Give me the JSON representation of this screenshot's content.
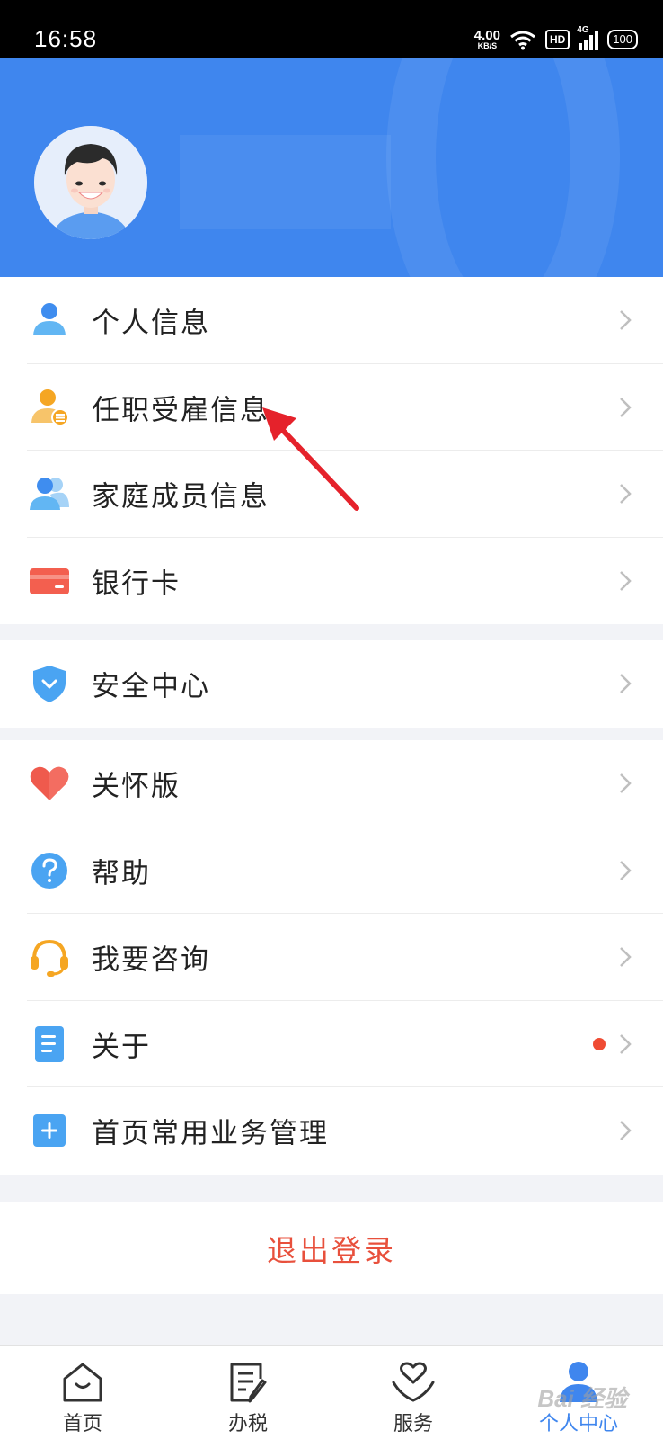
{
  "status_bar": {
    "time": "16:58",
    "net_speed_value": "4.00",
    "net_speed_unit": "KB/S",
    "hd_label": "HD",
    "network_label": "4G",
    "battery": "100"
  },
  "menu_groups": [
    {
      "items": [
        {
          "label": "个人信息",
          "icon": "person-icon"
        },
        {
          "label": "任职受雇信息",
          "icon": "employment-icon"
        },
        {
          "label": "家庭成员信息",
          "icon": "family-icon"
        },
        {
          "label": "银行卡",
          "icon": "bank-card-icon"
        }
      ]
    },
    {
      "items": [
        {
          "label": "安全中心",
          "icon": "shield-icon"
        }
      ]
    },
    {
      "items": [
        {
          "label": "关怀版",
          "icon": "heart-icon"
        },
        {
          "label": "帮助",
          "icon": "question-icon"
        },
        {
          "label": "我要咨询",
          "icon": "headset-icon"
        },
        {
          "label": "关于",
          "icon": "document-icon",
          "badge": "red-dot"
        },
        {
          "label": "首页常用业务管理",
          "icon": "plus-square-icon"
        }
      ]
    }
  ],
  "logout_label": "退出登录",
  "bottom_nav": {
    "items": [
      {
        "label": "首页",
        "icon": "home-icon"
      },
      {
        "label": "办税",
        "icon": "edit-doc-icon"
      },
      {
        "label": "服务",
        "icon": "heart-hand-icon"
      },
      {
        "label": "个人中心",
        "icon": "user-icon",
        "active": true
      }
    ]
  },
  "watermark": "Bai 经验",
  "colors": {
    "header_blue": "#3f86ee",
    "logout_red": "#e8503c",
    "badge_red": "#ef4b33",
    "annotation_arrow": "#e5222b"
  }
}
